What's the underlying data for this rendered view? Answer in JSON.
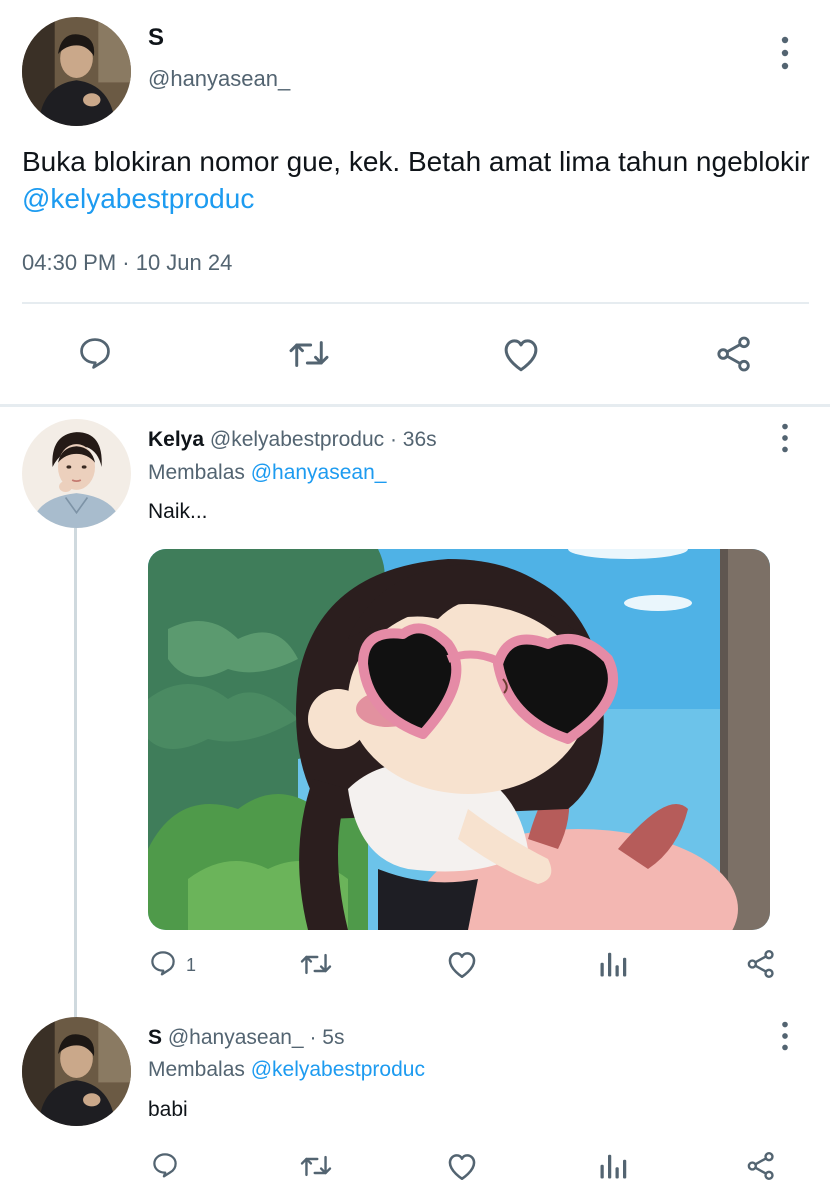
{
  "main_tweet": {
    "display_name": "S",
    "handle": "@hanyasean_",
    "text_prefix": "Buka blokiran nomor gue, kek. Betah amat lima tahun ngeblokir ",
    "text_mention": "@kelyabestproduc",
    "meta": "04:30 PM · 10 Jun 24"
  },
  "replies": [
    {
      "display_name": "Kelya",
      "handle": "@kelyabestproduc",
      "time": " · 36s",
      "replying_prefix": "Membalas ",
      "replying_mention": "@hanyasean_",
      "text": "Naik...",
      "reply_count": "1"
    },
    {
      "display_name": "S",
      "handle": "@hanyasean_",
      "time": " · 5s",
      "replying_prefix": "Membalas ",
      "replying_mention": "@kelyabestproduc",
      "text": "babi"
    }
  ],
  "icons": {
    "reply": "speech-bubble-icon",
    "retweet": "retweet-icon",
    "like": "heart-icon",
    "share": "share-icon",
    "views": "bar-chart-icon",
    "more": "vertical-dots-icon"
  },
  "colors": {
    "accent": "#1d9bf0",
    "secondary_text": "#536471",
    "primary_text": "#0f1419",
    "divider": "#e6ecf0"
  }
}
